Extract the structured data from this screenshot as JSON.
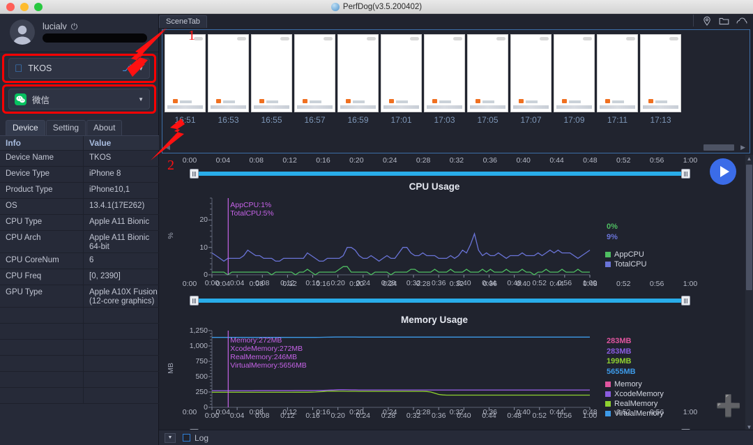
{
  "window": {
    "title": "PerfDog(v3.5.200402)",
    "traffic_lights": [
      "close",
      "minimize",
      "maximize"
    ]
  },
  "sidebar": {
    "user": {
      "name": "lucialv",
      "power_icon": "power-icon",
      "email_redacted": true
    },
    "device_select": {
      "label": "TKOS",
      "icon": "apple-icon",
      "usb_icon": "usb-icon",
      "caret": "chevron-down-icon"
    },
    "app_select": {
      "label": "微信",
      "icon": "wechat-icon",
      "caret": "chevron-down-icon"
    },
    "tabs": [
      {
        "label": "Device",
        "active": true
      },
      {
        "label": "Setting",
        "active": false
      },
      {
        "label": "About",
        "active": false
      }
    ],
    "table": {
      "headers": [
        "Info",
        "Value"
      ],
      "rows": [
        {
          "key": "Device Name",
          "value": "TKOS",
          "tall": false
        },
        {
          "key": "Device Type",
          "value": "iPhone 8",
          "tall": false
        },
        {
          "key": "Product Type",
          "value": "iPhone10,1",
          "tall": false
        },
        {
          "key": "OS",
          "value": "13.4.1(17E262)",
          "tall": false
        },
        {
          "key": "CPU Type",
          "value": "Apple A11 Bionic",
          "tall": false
        },
        {
          "key": "CPU Arch",
          "value": "Apple A11 Bionic 64-bit",
          "tall": true
        },
        {
          "key": "CPU CoreNum",
          "value": "6",
          "tall": false
        },
        {
          "key": "CPU Freq",
          "value": "[0, 2390]",
          "tall": false
        },
        {
          "key": "GPU Type",
          "value": "Apple A10X Fusion (12-core graphics)",
          "tall": true
        },
        {
          "key": "",
          "value": "",
          "tall": false
        },
        {
          "key": "",
          "value": "",
          "tall": false
        },
        {
          "key": "",
          "value": "",
          "tall": false
        },
        {
          "key": "",
          "value": "",
          "tall": false
        },
        {
          "key": "",
          "value": "",
          "tall": false
        },
        {
          "key": "",
          "value": "",
          "tall": false
        }
      ]
    }
  },
  "main": {
    "scene_tab": "SceneTab",
    "top_icons": [
      "location-pin-icon",
      "folder-icon",
      "cloud-icon"
    ],
    "thumbnails": [
      {
        "time": "16:51"
      },
      {
        "time": "16:53"
      },
      {
        "time": "16:55"
      },
      {
        "time": "16:57"
      },
      {
        "time": "16:59"
      },
      {
        "time": "17:01"
      },
      {
        "time": "17:03"
      },
      {
        "time": "17:05"
      },
      {
        "time": "17:07"
      },
      {
        "time": "17:09"
      },
      {
        "time": "17:11"
      },
      {
        "time": "17:13"
      }
    ],
    "play_button": "play-icon",
    "add_button": "plus-icon"
  },
  "timeline": {
    "ticks": [
      "0:00",
      "0:04",
      "0:08",
      "0:12",
      "0:16",
      "0:20",
      "0:24",
      "0:28",
      "0:32",
      "0:36",
      "0:40",
      "0:44",
      "0:48",
      "0:52",
      "0:56",
      "1:00"
    ]
  },
  "bottom": {
    "dropdown": "chevron-down-icon",
    "log_label": "Log",
    "log_checked": false
  },
  "annotations": [
    {
      "number": "1"
    },
    {
      "number": "2"
    }
  ],
  "colors": {
    "accent_blue": "#29adea",
    "app_cpu": "#4fbf62",
    "total_cpu": "#6a74d8",
    "memory": "#e0559f",
    "xcode_memory": "#8a5ce0",
    "real_memory": "#8fd130",
    "virtual_memory": "#3d9ae8",
    "cursor": "#c663e8",
    "annotation_red": "#ff0000"
  },
  "chart_data": [
    {
      "type": "line",
      "title": "CPU Usage",
      "xlabel": "",
      "ylabel": "%",
      "ylim": [
        0,
        28
      ],
      "yticks": [
        0,
        10,
        20
      ],
      "xticks": [
        "0:00",
        "0:04",
        "0:08",
        "0:12",
        "0:16",
        "0:20",
        "0:24",
        "0:28",
        "0:32",
        "0:36",
        "0:40",
        "0:44",
        "0:48",
        "0:52",
        "0:56",
        "1:00"
      ],
      "grid": false,
      "legend_position": "right",
      "cursor_annotation": [
        "AppCPU:1%",
        "TotalCPU:5%"
      ],
      "current_values": [
        {
          "name": "AppCPU",
          "value": "0%",
          "color": "#4fbf62"
        },
        {
          "name": "TotalCPU",
          "value": "9%",
          "color": "#6a74d8"
        }
      ],
      "series": [
        {
          "name": "AppCPU",
          "color": "#4fbf62",
          "values": [
            1,
            1,
            1,
            1,
            0,
            1,
            1,
            1,
            1,
            1,
            1,
            1,
            1,
            1,
            1,
            0,
            1,
            1,
            1,
            1,
            1,
            0,
            1,
            1,
            2,
            1,
            0,
            1,
            1,
            1,
            1,
            1,
            2,
            3,
            3,
            1,
            1,
            1,
            1,
            1,
            0,
            1,
            1,
            1,
            1,
            0,
            1,
            1,
            1,
            1,
            2,
            2,
            1,
            1,
            1,
            1,
            2,
            1,
            1,
            1,
            2,
            1,
            1,
            1,
            2,
            1,
            1,
            1,
            2,
            1,
            2,
            1,
            1,
            1,
            2,
            1,
            1,
            1,
            2,
            1,
            1,
            0,
            1,
            1,
            2,
            1,
            1,
            1,
            2,
            1,
            1,
            1,
            2,
            1,
            1,
            1
          ]
        },
        {
          "name": "TotalCPU",
          "color": "#6a74d8",
          "values": [
            8,
            7,
            6,
            5,
            6,
            6,
            6,
            6,
            7,
            9,
            8,
            7,
            7,
            6,
            6,
            6,
            5,
            5,
            6,
            6,
            6,
            6,
            6,
            6,
            8,
            7,
            6,
            5,
            5,
            6,
            6,
            6,
            6,
            7,
            10,
            10,
            9,
            7,
            6,
            6,
            7,
            6,
            5,
            6,
            7,
            6,
            6,
            8,
            10,
            10,
            8,
            7,
            7,
            8,
            7,
            7,
            7,
            6,
            6,
            6,
            7,
            6,
            7,
            9,
            8,
            11,
            15,
            9,
            7,
            8,
            7,
            7,
            8,
            7,
            6,
            7,
            7,
            7,
            8,
            7,
            7,
            7,
            8,
            7,
            8,
            9,
            8,
            9,
            8,
            8,
            8,
            7,
            6,
            7,
            8,
            9
          ]
        }
      ]
    },
    {
      "type": "line",
      "title": "Memory Usage",
      "xlabel": "",
      "ylabel": "MB",
      "ylim": [
        0,
        1250
      ],
      "yticks": [
        0,
        250,
        500,
        750,
        1000,
        1250
      ],
      "ytick_labels": [
        "0",
        "250",
        "500",
        "750",
        "1,000",
        "1,250"
      ],
      "xticks": [
        "0:00",
        "0:04",
        "0:08",
        "0:12",
        "0:16",
        "0:20",
        "0:24",
        "0:28",
        "0:32",
        "0:36",
        "0:40",
        "0:44",
        "0:48",
        "0:52",
        "0:56",
        "1:00"
      ],
      "grid": false,
      "legend_position": "right",
      "cursor_annotation": [
        "Memory:272MB",
        "XcodeMemory:272MB",
        "RealMemory:246MB",
        "VirtualMemory:5656MB"
      ],
      "current_values": [
        {
          "name": "Memory",
          "value": "283MB",
          "color": "#e0559f"
        },
        {
          "name": "XcodeMemory",
          "value": "283MB",
          "color": "#8a5ce0"
        },
        {
          "name": "RealMemory",
          "value": "199MB",
          "color": "#8fd130"
        },
        {
          "name": "VirtualMemory",
          "value": "5655MB",
          "color": "#3d9ae8"
        }
      ],
      "series": [
        {
          "name": "Memory",
          "color": "#e0559f",
          "scaled_values": [
            272,
            272,
            272,
            272,
            272,
            272,
            272,
            272,
            272,
            272,
            272,
            273,
            273,
            273,
            273,
            273,
            273,
            273,
            273,
            273,
            273,
            274,
            274,
            274,
            274,
            274,
            274,
            275,
            276,
            278,
            281,
            284,
            286,
            286,
            285,
            284,
            284,
            283,
            283,
            283,
            283,
            283,
            283,
            283,
            283,
            283,
            283,
            283,
            283,
            283,
            283,
            283,
            283,
            283,
            283,
            283,
            283,
            283,
            283,
            283,
            283,
            283,
            283,
            283,
            283,
            283,
            283,
            283,
            283,
            283,
            283,
            283,
            283,
            283,
            283,
            283,
            283,
            283,
            283,
            283,
            283,
            283,
            283,
            283,
            283,
            283,
            283,
            283,
            283,
            283,
            283,
            283,
            283,
            283,
            283,
            283
          ]
        },
        {
          "name": "XcodeMemory",
          "color": "#8a5ce0",
          "scaled_values": [
            272,
            272,
            272,
            272,
            272,
            272,
            272,
            272,
            272,
            272,
            272,
            273,
            273,
            273,
            273,
            273,
            273,
            273,
            273,
            273,
            273,
            274,
            274,
            274,
            274,
            274,
            274,
            275,
            276,
            278,
            281,
            284,
            286,
            286,
            285,
            284,
            284,
            283,
            283,
            283,
            283,
            283,
            283,
            283,
            283,
            283,
            283,
            283,
            283,
            283,
            283,
            283,
            283,
            283,
            283,
            283,
            283,
            283,
            283,
            283,
            283,
            283,
            283,
            283,
            283,
            283,
            283,
            283,
            283,
            283,
            283,
            283,
            283,
            283,
            283,
            283,
            283,
            283,
            283,
            283,
            283,
            283,
            283,
            283,
            283,
            283,
            283,
            283,
            283,
            283,
            283,
            283,
            283,
            283,
            283,
            283
          ]
        },
        {
          "name": "RealMemory",
          "color": "#8fd130",
          "scaled_values": [
            246,
            246,
            246,
            246,
            246,
            246,
            246,
            246,
            246,
            246,
            246,
            246,
            246,
            246,
            246,
            246,
            246,
            246,
            246,
            246,
            246,
            247,
            247,
            247,
            247,
            248,
            250,
            254,
            258,
            262,
            264,
            264,
            263,
            262,
            261,
            261,
            261,
            260,
            260,
            260,
            260,
            260,
            260,
            260,
            260,
            260,
            260,
            260,
            260,
            260,
            260,
            260,
            260,
            260,
            258,
            250,
            230,
            210,
            202,
            199,
            199,
            199,
            199,
            199,
            199,
            199,
            199,
            199,
            199,
            199,
            199,
            199,
            199,
            199,
            199,
            199,
            199,
            199,
            199,
            199,
            199,
            199,
            199,
            199,
            199,
            199,
            199,
            199,
            199,
            199,
            199,
            199,
            199,
            199,
            199,
            199
          ]
        },
        {
          "name": "VirtualMemory",
          "color": "#3d9ae8",
          "scaled_values": [
            1140,
            1140,
            1140,
            1140,
            1140,
            1140,
            1140,
            1140,
            1140,
            1140,
            1140,
            1140,
            1140,
            1140,
            1140,
            1140,
            1140,
            1140,
            1140,
            1140,
            1140,
            1140,
            1140,
            1140,
            1140,
            1140,
            1140,
            1141,
            1142,
            1143,
            1144,
            1145,
            1145,
            1145,
            1145,
            1145,
            1145,
            1144,
            1144,
            1144,
            1144,
            1144,
            1144,
            1144,
            1144,
            1144,
            1144,
            1144,
            1144,
            1144,
            1144,
            1144,
            1144,
            1144,
            1144,
            1144,
            1144,
            1144,
            1144,
            1144,
            1144,
            1144,
            1144,
            1144,
            1144,
            1144,
            1144,
            1144,
            1144,
            1144,
            1144,
            1144,
            1144,
            1144,
            1144,
            1144,
            1144,
            1144,
            1144,
            1144,
            1144,
            1144,
            1144,
            1144,
            1144,
            1144,
            1144,
            1144,
            1144,
            1144,
            1144,
            1144,
            1144,
            1144,
            1144,
            1144
          ]
        }
      ]
    }
  ]
}
